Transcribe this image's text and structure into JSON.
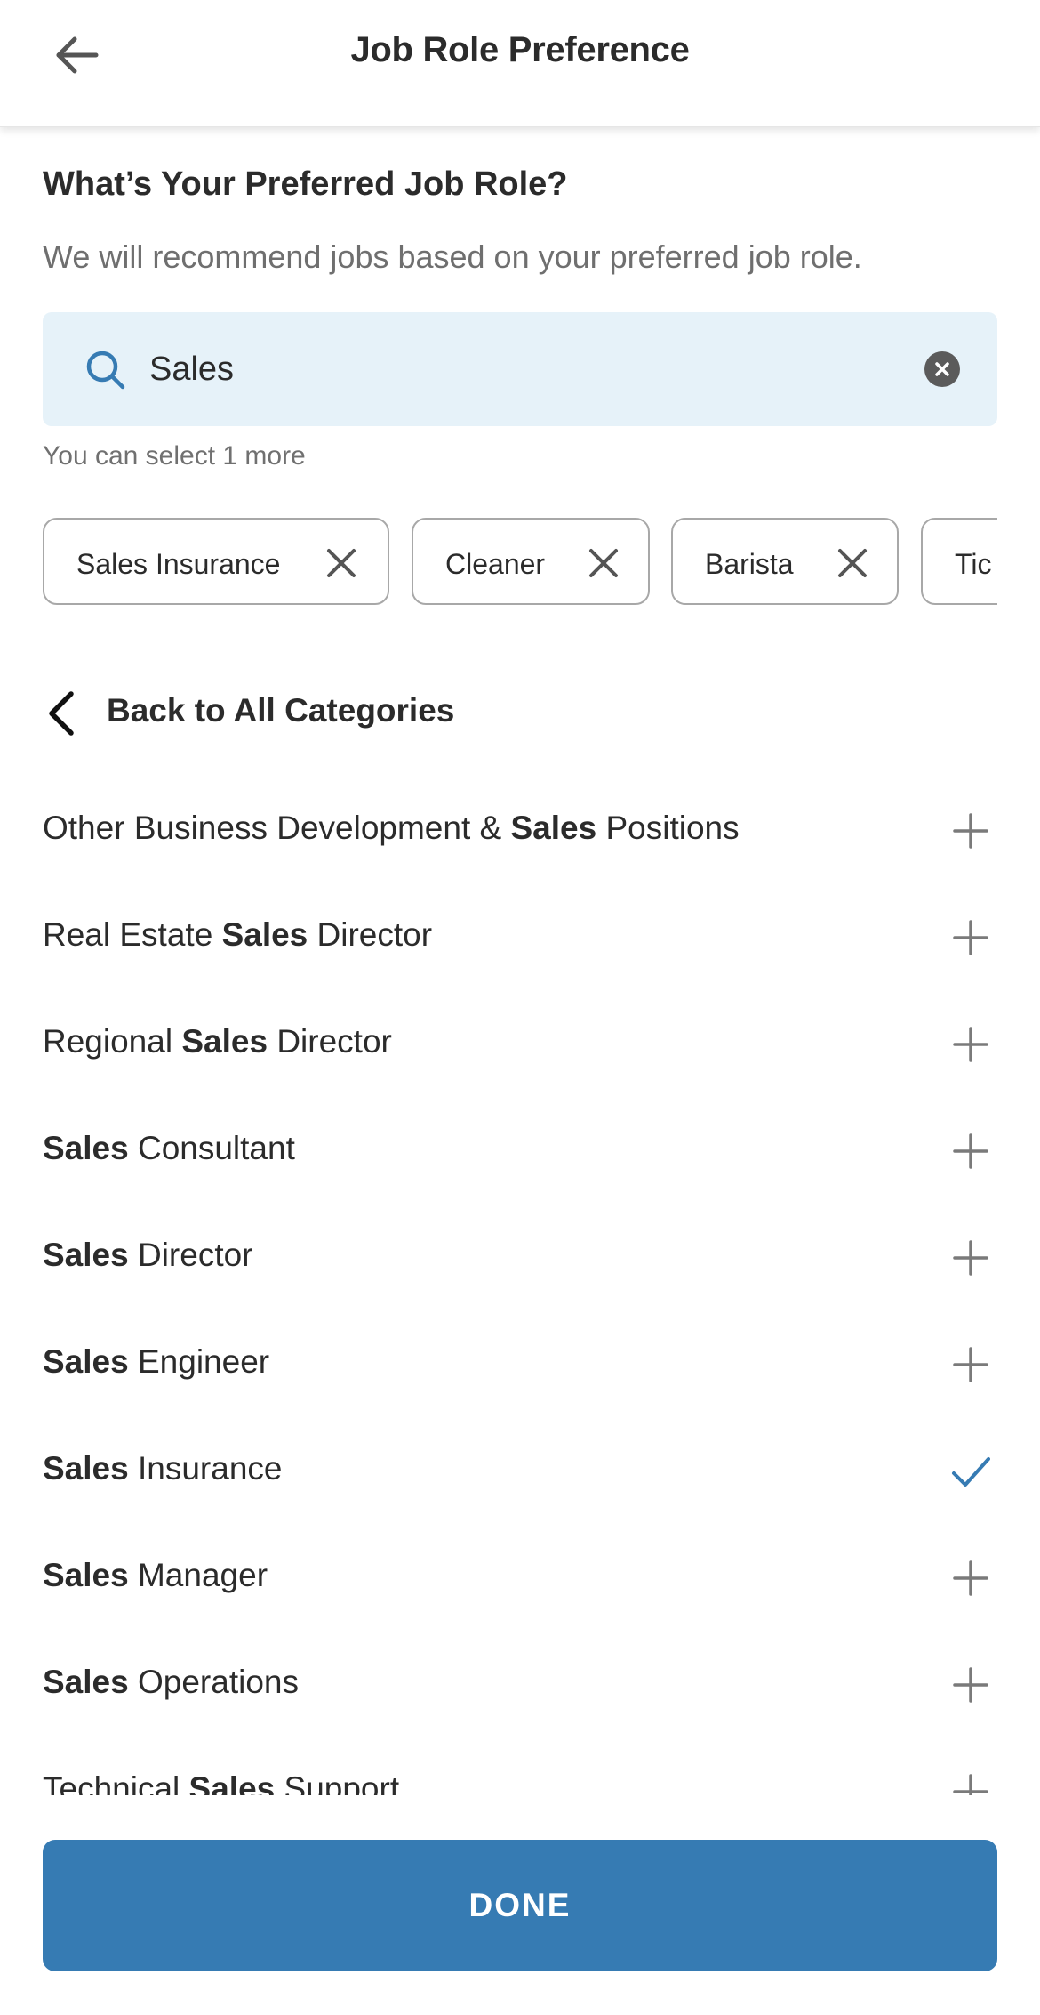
{
  "header": {
    "title": "Job Role Preference",
    "back_icon": "arrow-left-icon"
  },
  "intro": {
    "question": "What’s Your Preferred Job Role?",
    "subtitle": "We will recommend jobs based on your preferred job role."
  },
  "search": {
    "value": "Sales",
    "icon": "search-icon",
    "clear_icon": "close-circle-icon",
    "accent_color": "#367bb3",
    "background_color": "#e6f2f9"
  },
  "hint": "You can select 1 more",
  "selected_chips": [
    {
      "label": "Sales Insurance"
    },
    {
      "label": "Cleaner"
    },
    {
      "label": "Barista"
    },
    {
      "label": "Tic"
    }
  ],
  "back_to_categories": {
    "label": "Back to All Categories",
    "icon": "chevron-left-icon"
  },
  "results": [
    {
      "parts": [
        {
          "t": "Other Business Development & ",
          "b": false
        },
        {
          "t": "Sales",
          "b": true
        },
        {
          "t": " Positions",
          "b": false
        }
      ],
      "selected": false
    },
    {
      "parts": [
        {
          "t": "Real Estate ",
          "b": false
        },
        {
          "t": "Sales",
          "b": true
        },
        {
          "t": " Director",
          "b": false
        }
      ],
      "selected": false
    },
    {
      "parts": [
        {
          "t": "Regional ",
          "b": false
        },
        {
          "t": "Sales",
          "b": true
        },
        {
          "t": " Director",
          "b": false
        }
      ],
      "selected": false
    },
    {
      "parts": [
        {
          "t": "Sales",
          "b": true
        },
        {
          "t": " Consultant",
          "b": false
        }
      ],
      "selected": false
    },
    {
      "parts": [
        {
          "t": "Sales",
          "b": true
        },
        {
          "t": " Director",
          "b": false
        }
      ],
      "selected": false
    },
    {
      "parts": [
        {
          "t": "Sales",
          "b": true
        },
        {
          "t": " Engineer",
          "b": false
        }
      ],
      "selected": false
    },
    {
      "parts": [
        {
          "t": "Sales",
          "b": true
        },
        {
          "t": " Insurance",
          "b": false
        }
      ],
      "selected": true
    },
    {
      "parts": [
        {
          "t": "Sales",
          "b": true
        },
        {
          "t": " Manager",
          "b": false
        }
      ],
      "selected": false
    },
    {
      "parts": [
        {
          "t": "Sales",
          "b": true
        },
        {
          "t": " Operations",
          "b": false
        }
      ],
      "selected": false
    },
    {
      "parts": [
        {
          "t": "Technical ",
          "b": false
        },
        {
          "t": "Sales",
          "b": true
        },
        {
          "t": " Support",
          "b": false
        }
      ],
      "selected": false
    }
  ],
  "icons": {
    "add": "plus-icon",
    "selected": "checkmark-icon",
    "remove_chip": "close-icon"
  },
  "done_button": {
    "label": "DONE",
    "color": "#367bb3"
  }
}
